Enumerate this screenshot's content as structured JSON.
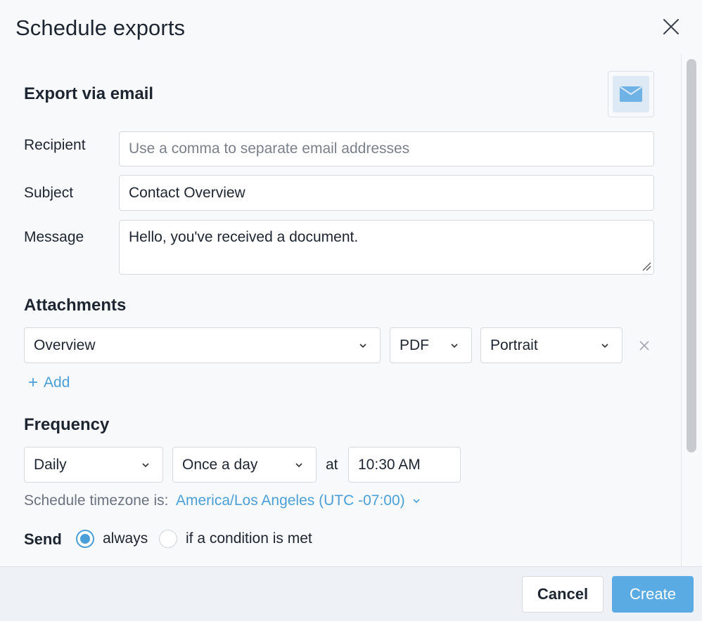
{
  "dialog": {
    "title": "Schedule exports"
  },
  "email_section": {
    "title": "Export via email",
    "icon": "envelope-icon"
  },
  "recipient": {
    "label": "Recipient",
    "placeholder": "Use a comma to separate email addresses",
    "value": ""
  },
  "subject": {
    "label": "Subject",
    "value": "Contact Overview"
  },
  "message": {
    "label": "Message",
    "value": "Hello, you've received a document."
  },
  "attachments": {
    "title": "Attachments",
    "items": [
      {
        "dashboard": "Overview",
        "format": "PDF",
        "orientation": "Portrait"
      }
    ],
    "add_label": "Add"
  },
  "frequency": {
    "title": "Frequency",
    "period": "Daily",
    "times": "Once a day",
    "at_label": "at",
    "time": "10:30 AM",
    "timezone_label": "Schedule timezone is:",
    "timezone": "America/Los Angeles (UTC -07:00)"
  },
  "send": {
    "label": "Send",
    "options": [
      {
        "label": "always",
        "checked": true
      },
      {
        "label": "if a condition is met",
        "checked": false
      }
    ]
  },
  "footer": {
    "cancel_label": "Cancel",
    "create_label": "Create"
  },
  "colors": {
    "accent": "#4a9fd8",
    "primary_button": "#5aaae3",
    "text": "#1d2530"
  }
}
